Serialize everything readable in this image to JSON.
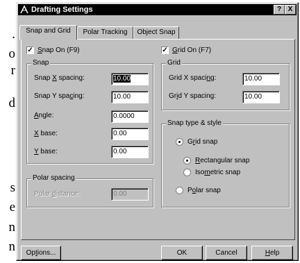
{
  "page_side_text": [
    ".",
    "o",
    "r",
    "d",
    "s",
    "e",
    "n",
    "n"
  ],
  "dialog": {
    "title": "Drafting Settings",
    "help_button": "?",
    "close_button": "X"
  },
  "tabs": [
    {
      "label": "Snap and Grid"
    },
    {
      "label": "Polar Tracking"
    },
    {
      "label": "Object Snap"
    }
  ],
  "snap_on": {
    "pre": "",
    "key": "S",
    "post": "nap On (F9)",
    "checked": true
  },
  "grid_on": {
    "pre": "",
    "key": "G",
    "post": "rid On (F7)",
    "checked": true
  },
  "snap_group": {
    "title": "Snap",
    "x_spacing": {
      "pre": "Snap ",
      "key": "X",
      "post": " spacing:",
      "value": "10.00"
    },
    "y_spacing": {
      "pre": "Snap Y spa",
      "key": "c",
      "post": "ing:",
      "value": "10.00"
    },
    "angle": {
      "pre": "",
      "key": "A",
      "post": "ngle:",
      "value": "0.0000"
    },
    "x_base": {
      "pre": "",
      "key": "X",
      "post": " base:",
      "value": "0.00"
    },
    "y_base": {
      "pre": "",
      "key": "Y",
      "post": " base:",
      "value": "0.00"
    }
  },
  "grid_group": {
    "title": "Grid",
    "x_spacing": {
      "pre": "Grid X spaci",
      "key": "n",
      "post": "g:",
      "value": "10.00"
    },
    "y_spacing": {
      "pre": "Gr",
      "key": "i",
      "post": "d Y spacing:",
      "value": "10.00"
    }
  },
  "polar_group": {
    "title": "Polar spacing",
    "distance": {
      "pre": "Polar ",
      "key": "d",
      "post": "istance:",
      "value": "0.00"
    }
  },
  "snap_type_group": {
    "title": "Snap type & style",
    "grid_snap": {
      "pre": "G",
      "key": "r",
      "post": "id snap",
      "selected": true
    },
    "rectangular_snap": {
      "pre": "",
      "key": "R",
      "post": "ectangular snap",
      "selected": true
    },
    "isometric_snap": {
      "pre": "Iso",
      "key": "m",
      "post": "etric snap",
      "selected": false
    },
    "polar_snap": {
      "pre": "P",
      "key": "o",
      "post": "lar snap",
      "selected": false
    }
  },
  "buttons": {
    "options": {
      "pre": "Op",
      "key": "t",
      "post": "ions..."
    },
    "ok": "OK",
    "cancel": "Cancel",
    "help": {
      "pre": "",
      "key": "H",
      "post": "elp"
    }
  }
}
